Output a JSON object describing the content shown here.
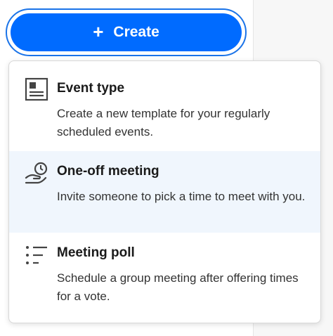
{
  "create_button": {
    "label": "Create",
    "icon": "plus-icon"
  },
  "menu": {
    "items": [
      {
        "title": "Event type",
        "description": "Create a new template for your regularly scheduled events.",
        "icon": "template-document-icon"
      },
      {
        "title": "One-off meeting",
        "description": "Invite someone to pick a time to meet with you.",
        "icon": "hand-clock-icon",
        "highlighted": true
      },
      {
        "title": "Meeting poll",
        "description": "Schedule a group meeting after offering times for a vote.",
        "icon": "list-poll-icon"
      }
    ]
  },
  "colors": {
    "primary": "#006bff",
    "focus_ring": "#1a73e8",
    "hover_bg": "#f0f6fd"
  }
}
